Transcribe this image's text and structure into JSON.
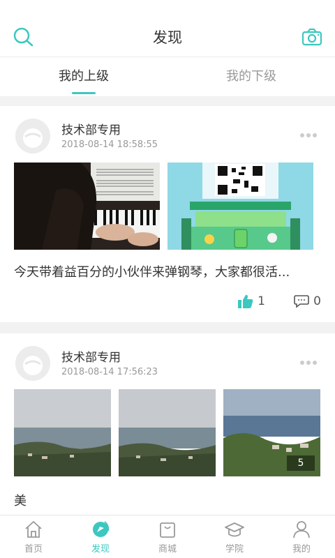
{
  "header": {
    "title": "发现",
    "icons": {
      "left": "search-icon",
      "right": "camera-icon"
    }
  },
  "tabs": [
    {
      "label": "我的上级",
      "active": true
    },
    {
      "label": "我的下级",
      "active": false
    }
  ],
  "posts": [
    {
      "author": "技术部专用",
      "time": "2018-08-14 18:58:55",
      "caption": "今天带着益百分的小伙伴来弹钢琴，大家都很活...",
      "likes": "1",
      "comments": "0"
    },
    {
      "author": "技术部专用",
      "time": "2018-08-14 17:56:23",
      "caption": "美",
      "more_images": "5"
    }
  ],
  "bottom_nav": [
    {
      "label": "首页",
      "icon": "home-icon"
    },
    {
      "label": "发现",
      "icon": "discover-icon",
      "active": true
    },
    {
      "label": "商城",
      "icon": "shop-icon"
    },
    {
      "label": "学院",
      "icon": "academy-icon"
    },
    {
      "label": "我的",
      "icon": "profile-icon"
    }
  ],
  "colors": {
    "accent": "#3cc7c0",
    "background": "#f2f2f2",
    "text": "#333333",
    "muted": "#999999"
  }
}
